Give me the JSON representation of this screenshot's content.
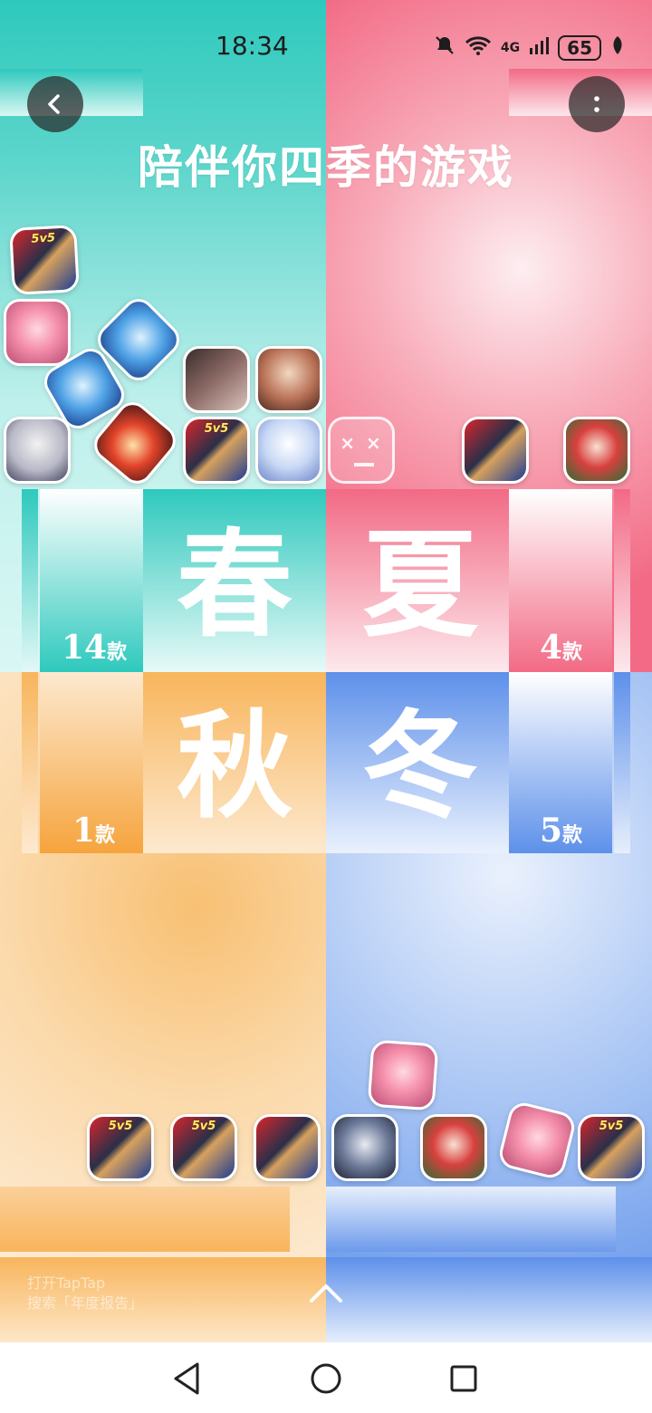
{
  "status_bar": {
    "time": "18:34",
    "network": "4G",
    "battery": "65"
  },
  "header": {
    "title": "陪伴你四季的游戏"
  },
  "seasons": {
    "spring": {
      "name": "春",
      "count": "14",
      "unit": "款",
      "color": "#2ec9bd"
    },
    "summer": {
      "name": "夏",
      "count": "4",
      "unit": "款",
      "color": "#f26a85"
    },
    "autumn": {
      "name": "秋",
      "count": "1",
      "unit": "款",
      "color": "#f8b55c"
    },
    "winter": {
      "name": "冬",
      "count": "5",
      "unit": "款",
      "color": "#5d90ea"
    }
  },
  "game_tag": "5v5",
  "footer": {
    "hint_line1": "打开TapTap",
    "hint_line2": "搜索「年度报告」"
  },
  "icons": {
    "back": "chevron-left-icon",
    "more": "more-vertical-icon",
    "up": "chevron-up-icon",
    "nav_back": "triangle-back-icon",
    "nav_home": "circle-home-icon",
    "nav_recent": "square-recent-icon"
  }
}
